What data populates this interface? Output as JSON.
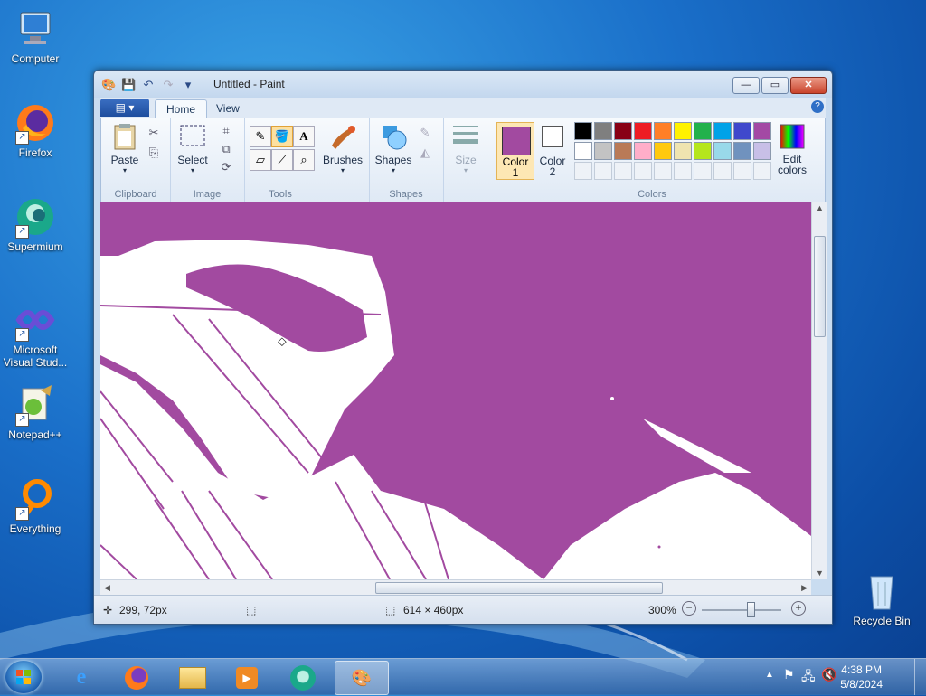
{
  "desktop": {
    "icons": [
      {
        "label": "Computer"
      },
      {
        "label": "Firefox"
      },
      {
        "label": "Supermium"
      },
      {
        "label": "Microsoft Visual Stud..."
      },
      {
        "label": "Notepad++"
      },
      {
        "label": "Everything"
      },
      {
        "label": "Recycle Bin"
      }
    ]
  },
  "window": {
    "title": "Untitled - Paint",
    "file_menu": "▤ ▾",
    "tabs": [
      {
        "label": "Home"
      },
      {
        "label": "View"
      }
    ],
    "groups": {
      "clipboard": "Clipboard",
      "image": "Image",
      "tools": "Tools",
      "shapes": "Shapes",
      "colors": "Colors"
    },
    "buttons": {
      "paste": "Paste",
      "select": "Select",
      "brushes": "Brushes",
      "shapes": "Shapes",
      "size": "Size",
      "color1_a": "Color",
      "color1_b": "1",
      "color2_a": "Color",
      "color2_b": "2",
      "edit_colors_a": "Edit",
      "edit_colors_b": "colors"
    },
    "colors": {
      "color1": "#a24aa0",
      "color2": "#ffffff",
      "palette_row1": [
        "#000000",
        "#7f7f7f",
        "#880015",
        "#ed1c24",
        "#ff7f27",
        "#fff200",
        "#22b14c",
        "#00a2e8",
        "#3f48cc",
        "#a349a4"
      ],
      "palette_row2": [
        "#ffffff",
        "#c3c3c3",
        "#b97a57",
        "#ffaec9",
        "#ffc90e",
        "#efe4b0",
        "#b5e61d",
        "#99d9ea",
        "#7092be",
        "#c8bfe7"
      ]
    },
    "status": {
      "cursor_pos": "299, 72px",
      "image_size": "614 × 460px",
      "zoom": "300%"
    }
  },
  "taskbar": {
    "time": "4:38 PM",
    "date": "5/8/2024"
  }
}
